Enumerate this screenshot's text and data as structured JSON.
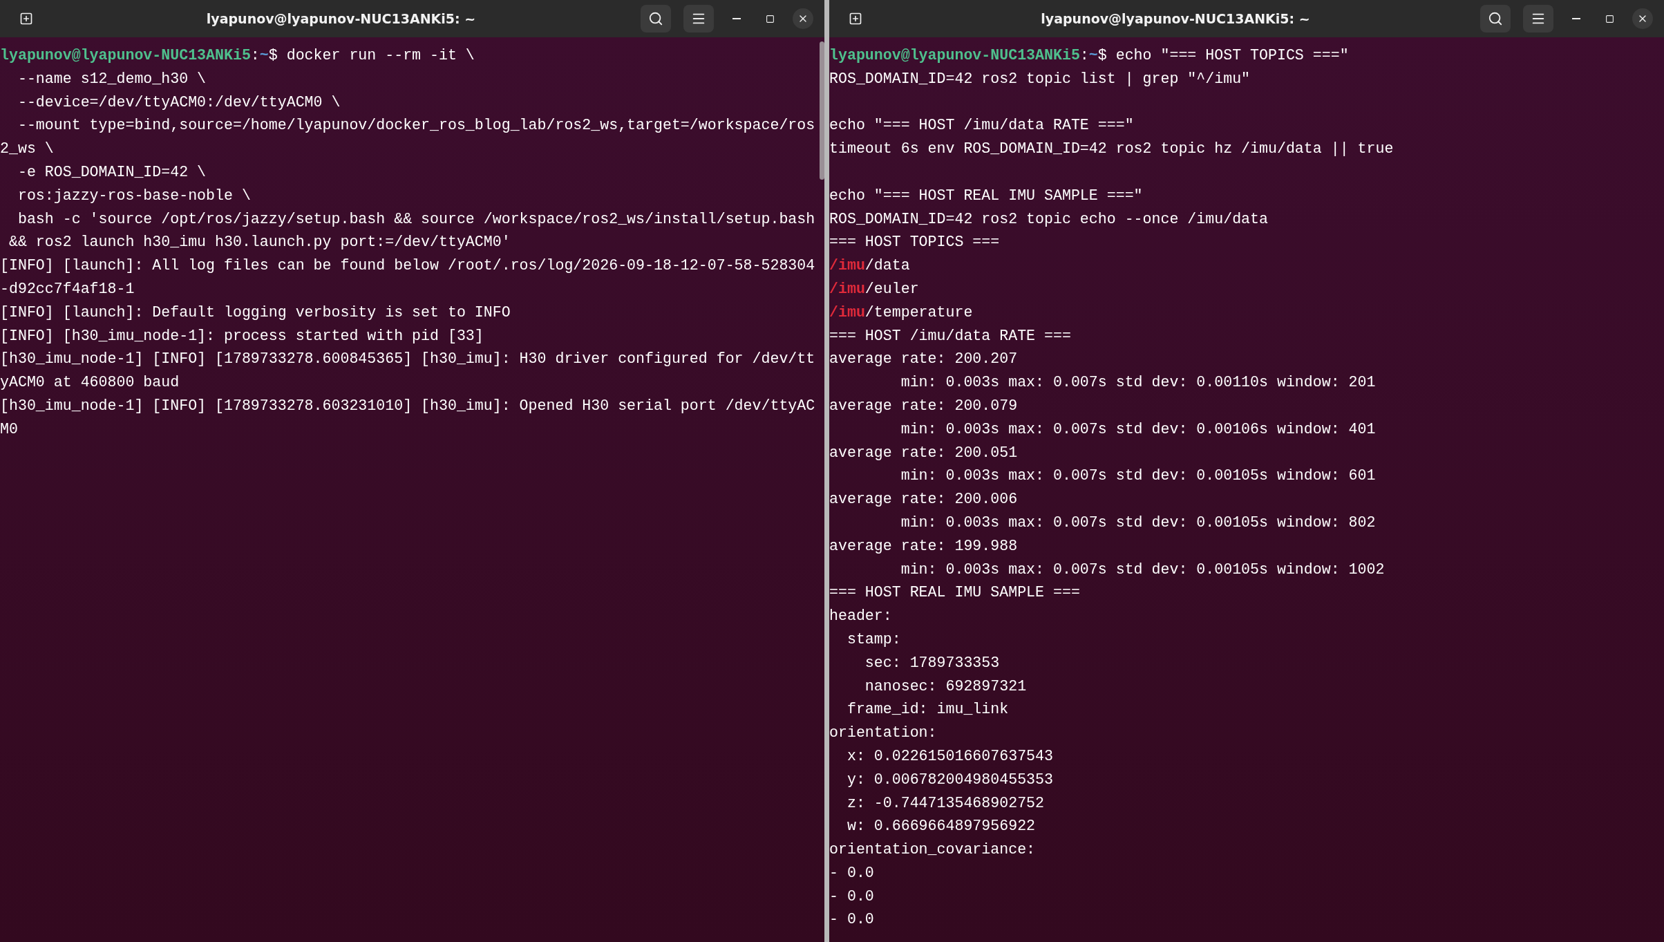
{
  "windows": [
    {
      "title": "lyapunov@lyapunov-NUC13ANKi5: ~",
      "lines": [
        {
          "kind": "prompt",
          "user": "lyapunov@lyapunov-NUC13ANKi5",
          "separator": ":",
          "path": "~",
          "command": "$ docker run --rm -it \\"
        },
        {
          "kind": "plain",
          "text": "  --name s12_demo_h30 \\"
        },
        {
          "kind": "plain",
          "text": "  --device=/dev/ttyACM0:/dev/ttyACM0 \\"
        },
        {
          "kind": "plain",
          "text": "  --mount type=bind,source=/home/lyapunov/docker_ros_blog_lab/ros2_ws,target=/workspace/ros"
        },
        {
          "kind": "plain",
          "text": "2_ws \\"
        },
        {
          "kind": "plain",
          "text": "  -e ROS_DOMAIN_ID=42 \\"
        },
        {
          "kind": "plain",
          "text": "  ros:jazzy-ros-base-noble \\"
        },
        {
          "kind": "plain",
          "text": "  bash -c 'source /opt/ros/jazzy/setup.bash && source /workspace/ros2_ws/install/setup.bash"
        },
        {
          "kind": "plain",
          "text": " && ros2 launch h30_imu h30.launch.py port:=/dev/ttyACM0'"
        },
        {
          "kind": "plain",
          "text": "[INFO] [launch]: All log files can be found below /root/.ros/log/2026-09-18-12-07-58-528304"
        },
        {
          "kind": "plain",
          "text": "-d92cc7f4af18-1"
        },
        {
          "kind": "plain",
          "text": "[INFO] [launch]: Default logging verbosity is set to INFO"
        },
        {
          "kind": "plain",
          "text": "[INFO] [h30_imu_node-1]: process started with pid [33]"
        },
        {
          "kind": "plain",
          "text": "[h30_imu_node-1] [INFO] [1789733278.600845365] [h30_imu]: H30 driver configured for /dev/tt"
        },
        {
          "kind": "plain",
          "text": "yACM0 at 460800 baud"
        },
        {
          "kind": "plain",
          "text": "[h30_imu_node-1] [INFO] [1789733278.603231010] [h30_imu]: Opened H30 serial port /dev/ttyAC"
        },
        {
          "kind": "plain",
          "text": "M0"
        }
      ]
    },
    {
      "title": "lyapunov@lyapunov-NUC13ANKi5: ~",
      "lines": [
        {
          "kind": "prompt",
          "user": "lyapunov@lyapunov-NUC13ANKi5",
          "separator": ":",
          "path": "~",
          "command": "$ echo \"=== HOST TOPICS ===\""
        },
        {
          "kind": "plain",
          "text": "ROS_DOMAIN_ID=42 ros2 topic list | grep \"^/imu\""
        },
        {
          "kind": "blank"
        },
        {
          "kind": "plain",
          "text": "echo \"=== HOST /imu/data RATE ===\""
        },
        {
          "kind": "plain",
          "text": "timeout 6s env ROS_DOMAIN_ID=42 ros2 topic hz /imu/data || true"
        },
        {
          "kind": "blank"
        },
        {
          "kind": "plain",
          "text": "echo \"=== HOST REAL IMU SAMPLE ===\""
        },
        {
          "kind": "plain",
          "text": "ROS_DOMAIN_ID=42 ros2 topic echo --once /imu/data"
        },
        {
          "kind": "plain",
          "text": "=== HOST TOPICS ==="
        },
        {
          "kind": "match",
          "match": "/imu",
          "rest": "/data"
        },
        {
          "kind": "match",
          "match": "/imu",
          "rest": "/euler"
        },
        {
          "kind": "match",
          "match": "/imu",
          "rest": "/temperature"
        },
        {
          "kind": "plain",
          "text": "=== HOST /imu/data RATE ==="
        },
        {
          "kind": "plain",
          "text": "average rate: 200.207"
        },
        {
          "kind": "plain",
          "text": "\tmin: 0.003s max: 0.007s std dev: 0.00110s window: 201"
        },
        {
          "kind": "plain",
          "text": "average rate: 200.079"
        },
        {
          "kind": "plain",
          "text": "\tmin: 0.003s max: 0.007s std dev: 0.00106s window: 401"
        },
        {
          "kind": "plain",
          "text": "average rate: 200.051"
        },
        {
          "kind": "plain",
          "text": "\tmin: 0.003s max: 0.007s std dev: 0.00105s window: 601"
        },
        {
          "kind": "plain",
          "text": "average rate: 200.006"
        },
        {
          "kind": "plain",
          "text": "\tmin: 0.003s max: 0.007s std dev: 0.00105s window: 802"
        },
        {
          "kind": "plain",
          "text": "average rate: 199.988"
        },
        {
          "kind": "plain",
          "text": "\tmin: 0.003s max: 0.007s std dev: 0.00105s window: 1002"
        },
        {
          "kind": "plain",
          "text": "=== HOST REAL IMU SAMPLE ==="
        },
        {
          "kind": "plain",
          "text": "header:"
        },
        {
          "kind": "plain",
          "text": "  stamp:"
        },
        {
          "kind": "plain",
          "text": "    sec: 1789733353"
        },
        {
          "kind": "plain",
          "text": "    nanosec: 692897321"
        },
        {
          "kind": "plain",
          "text": "  frame_id: imu_link"
        },
        {
          "kind": "plain",
          "text": "orientation:"
        },
        {
          "kind": "plain",
          "text": "  x: 0.022615016607637543"
        },
        {
          "kind": "plain",
          "text": "  y: 0.006782004980455353"
        },
        {
          "kind": "plain",
          "text": "  z: -0.7447135468902752"
        },
        {
          "kind": "plain",
          "text": "  w: 0.6669664897956922"
        },
        {
          "kind": "plain",
          "text": "orientation_covariance:"
        },
        {
          "kind": "plain",
          "text": "- 0.0"
        },
        {
          "kind": "plain",
          "text": "- 0.0"
        },
        {
          "kind": "plain",
          "text": "- 0.0"
        }
      ]
    }
  ]
}
